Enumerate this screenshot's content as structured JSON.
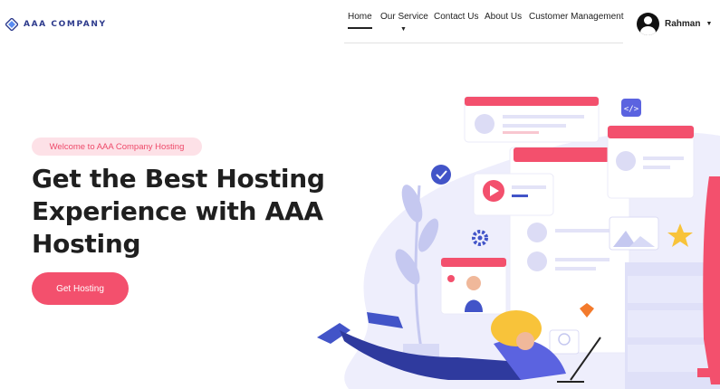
{
  "brand": {
    "name": "AAA COMPANY"
  },
  "nav": {
    "items": [
      {
        "label": "Home"
      },
      {
        "label": "Our Service"
      },
      {
        "label": "Contact Us"
      },
      {
        "label": "About Us"
      },
      {
        "label": "Customer Management"
      }
    ]
  },
  "user": {
    "name": "Rahman"
  },
  "hero": {
    "badge": "Welcome to AAA Company Hosting",
    "title_line1": "Get the Best Hosting",
    "title_line2": "Experience with AAA",
    "title_line3": "Hosting",
    "cta_label": "Get Hosting"
  },
  "colors": {
    "accent": "#f3506d",
    "badge_bg": "#fde1e7",
    "brand_blue": "#2d3a8c",
    "illustration_lavender": "#e9e9fb",
    "illustration_indigo": "#3f4bb8"
  }
}
